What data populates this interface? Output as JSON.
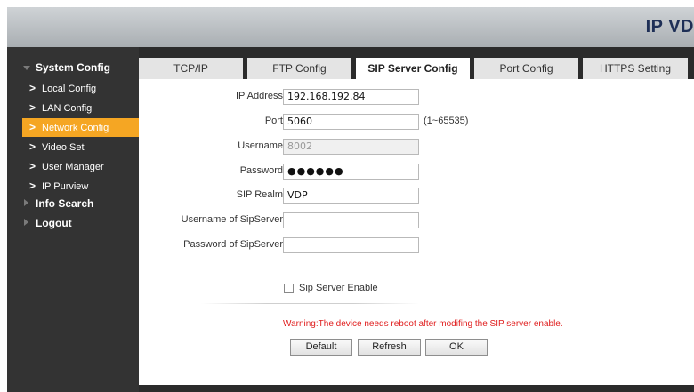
{
  "header": {
    "brand": "IP VD"
  },
  "sidebar": {
    "groups": [
      {
        "label": "System Config"
      },
      {
        "label": "Info Search"
      },
      {
        "label": "Logout"
      }
    ],
    "items": [
      {
        "label": "Local Config"
      },
      {
        "label": "LAN Config"
      },
      {
        "label": "Network Config"
      },
      {
        "label": "Video Set"
      },
      {
        "label": "User Manager"
      },
      {
        "label": "IP Purview"
      }
    ],
    "active_item": "Network Config",
    "chevron": ">"
  },
  "tabs": [
    {
      "label": "TCP/IP"
    },
    {
      "label": "FTP Config"
    },
    {
      "label": "SIP Server Config"
    },
    {
      "label": "Port Config"
    },
    {
      "label": "HTTPS Setting"
    }
  ],
  "active_tab": "SIP Server Config",
  "form": {
    "ip_address": {
      "label": "IP Address",
      "value": "192.168.192.84"
    },
    "port": {
      "label": "Port",
      "value": "5060",
      "hint": "(1~65535)"
    },
    "username": {
      "label": "Username",
      "value": "8002"
    },
    "password": {
      "label": "Password",
      "value": "●●●●●●"
    },
    "sip_realm": {
      "label": "SIP Realm",
      "value": "VDP"
    },
    "username_sipserver": {
      "label": "Username of SipServer",
      "value": ""
    },
    "password_sipserver": {
      "label": "Password of SipServer",
      "value": ""
    },
    "sip_server_enable": {
      "label": "Sip Server Enable",
      "checked": false
    }
  },
  "warning": "Warning:The device needs reboot after modifing the SIP server enable.",
  "buttons": {
    "default": "Default",
    "refresh": "Refresh",
    "ok": "OK"
  },
  "colors": {
    "active_highlight": "#f5a623",
    "warning": "#e02020",
    "brand": "#1e2f56"
  }
}
